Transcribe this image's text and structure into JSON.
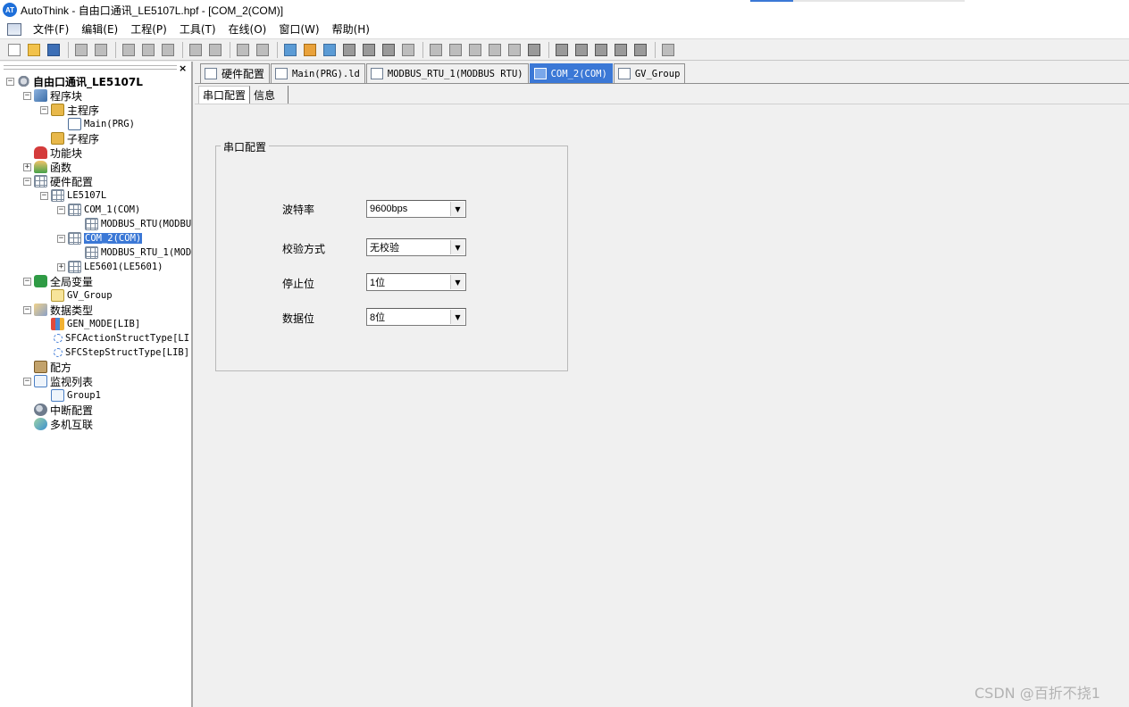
{
  "window": {
    "title": "AutoThink - 自由口通讯_LE5107L.hpf - [COM_2(COM)]",
    "logo_text": "AT"
  },
  "menu": [
    "文件(F)",
    "编辑(E)",
    "工程(P)",
    "工具(T)",
    "在线(O)",
    "窗口(W)",
    "帮助(H)"
  ],
  "toolbar_icons": [
    "new-file-icon",
    "open-folder-icon",
    "save-icon",
    "sep",
    "print-icon",
    "print-preview-icon",
    "sep",
    "cut-icon",
    "copy-icon",
    "paste-icon",
    "sep",
    "undo-icon",
    "redo-icon",
    "sep",
    "find-icon",
    "replace-icon",
    "sep",
    "compile-icon",
    "download-icon",
    "online-icon",
    "run-icon",
    "pause-icon",
    "stop-icon",
    "monitor-icon",
    "sep",
    "indent-icon",
    "outdent-icon",
    "step-in-icon",
    "step-out-icon",
    "step-over-icon",
    "go-icon",
    "sep",
    "window1-icon",
    "window2-icon",
    "window3-icon",
    "window4-icon",
    "window5-icon",
    "sep",
    "screen-icon"
  ],
  "tree": [
    {
      "label": "自由口通讯_LE5107L",
      "icon": "project-icon",
      "level": 0,
      "expander": "minus",
      "style": "bold"
    },
    {
      "label": "程序块",
      "icon": "program-block-icon",
      "level": 1,
      "expander": "minus"
    },
    {
      "label": "主程序",
      "icon": "folder-icon",
      "level": 2,
      "expander": "minus"
    },
    {
      "label": "Main(PRG)",
      "icon": "program-icon",
      "level": 3,
      "expander": "none",
      "style": "mono"
    },
    {
      "label": "子程序",
      "icon": "folder-icon",
      "level": 2,
      "expander": "none"
    },
    {
      "label": "功能块",
      "icon": "function-block-icon",
      "level": 1,
      "expander": "none"
    },
    {
      "label": "函数",
      "icon": "function-icon",
      "level": 1,
      "expander": "plus"
    },
    {
      "label": "硬件配置",
      "icon": "hardware-icon",
      "level": 1,
      "expander": "minus"
    },
    {
      "label": "LE5107L",
      "icon": "hardware-icon",
      "level": 2,
      "expander": "minus",
      "style": "mono"
    },
    {
      "label": "COM_1(COM)",
      "icon": "hardware-icon",
      "level": 3,
      "expander": "minus",
      "style": "mono"
    },
    {
      "label": "MODBUS_RTU(MODBUS",
      "icon": "hardware-icon",
      "level": 4,
      "expander": "none",
      "style": "mono"
    },
    {
      "label": "COM_2(COM)",
      "icon": "hardware-icon",
      "level": 3,
      "expander": "minus",
      "style": "mono",
      "selected": true
    },
    {
      "label": "MODBUS_RTU_1(MOD",
      "icon": "hardware-icon",
      "level": 4,
      "expander": "none",
      "style": "mono"
    },
    {
      "label": "LE5601(LE5601)",
      "icon": "hardware-icon",
      "level": 3,
      "expander": "plus",
      "style": "mono"
    },
    {
      "label": "全局变量",
      "icon": "global-var-icon",
      "level": 1,
      "expander": "minus"
    },
    {
      "label": "GV_Group",
      "icon": "document-icon",
      "level": 2,
      "expander": "none",
      "style": "mono"
    },
    {
      "label": "数据类型",
      "icon": "data-type-icon",
      "level": 1,
      "expander": "minus"
    },
    {
      "label": "GEN_MODE[LIB]",
      "icon": "enum-icon",
      "level": 2,
      "expander": "none",
      "style": "mono"
    },
    {
      "label": "SFCActionStructType[LI",
      "icon": "struct-icon",
      "level": 2,
      "expander": "none",
      "style": "mono"
    },
    {
      "label": "SFCStepStructType[LIB]",
      "icon": "struct-icon",
      "level": 2,
      "expander": "none",
      "style": "mono"
    },
    {
      "label": "配方",
      "icon": "recipe-icon",
      "level": 1,
      "expander": "none"
    },
    {
      "label": "监视列表",
      "icon": "watch-list-icon",
      "level": 1,
      "expander": "minus"
    },
    {
      "label": "Group1",
      "icon": "watch-list-icon",
      "level": 2,
      "expander": "none",
      "style": "mono"
    },
    {
      "label": "中断配置",
      "icon": "interrupt-icon",
      "level": 1,
      "expander": "none"
    },
    {
      "label": "多机互联",
      "icon": "multi-link-icon",
      "level": 1,
      "expander": "none"
    }
  ],
  "doc_tabs": [
    {
      "label": "硬件配置",
      "icon": "hardware-icon",
      "mono": false,
      "active": false
    },
    {
      "label": "Main(PRG).ld",
      "icon": "ladder-icon",
      "mono": true,
      "active": false
    },
    {
      "label": "MODBUS_RTU_1(MODBUS RTU)",
      "icon": "hardware-icon",
      "mono": true,
      "active": false
    },
    {
      "label": "COM_2(COM)",
      "icon": "hardware-icon",
      "mono": true,
      "active": true
    },
    {
      "label": "GV_Group",
      "icon": "document-icon",
      "mono": true,
      "active": false
    }
  ],
  "sub_tabs": {
    "serial_config": "串口配置",
    "info": "信息"
  },
  "serial_group": {
    "title": "串口配置",
    "baud_rate_label": "波特率",
    "baud_rate_value": "9600bps",
    "parity_label": "校验方式",
    "parity_value": "无校验",
    "stop_bits_label": "停止位",
    "stop_bits_value": "1位",
    "data_bits_label": "数据位",
    "data_bits_value": "8位"
  },
  "watermark": "CSDN @百折不挠1",
  "colors": {
    "selection": "#3b78d6",
    "background": "#f0f0f0"
  }
}
